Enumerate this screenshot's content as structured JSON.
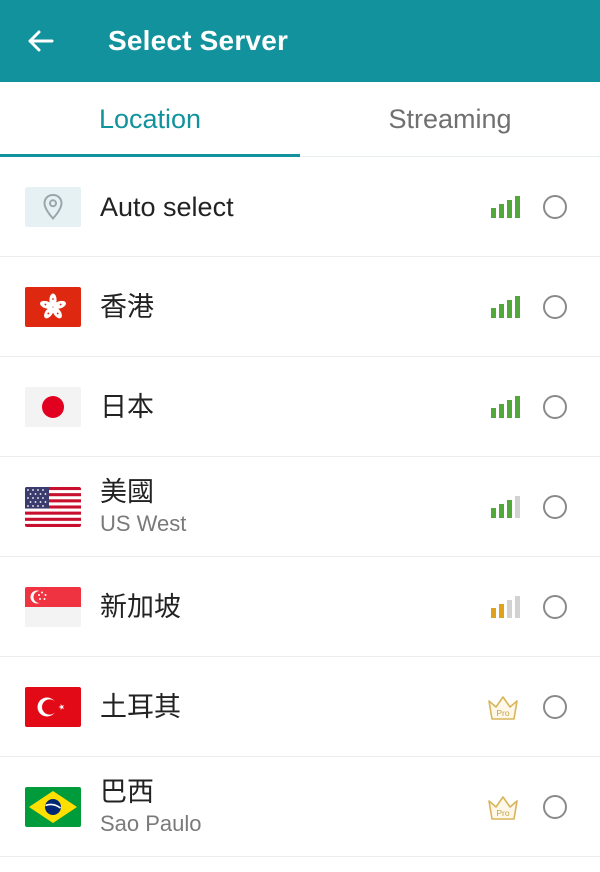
{
  "header": {
    "title": "Select Server",
    "back_icon": "arrow-left-icon"
  },
  "tabs": [
    {
      "label": "Location",
      "active": true
    },
    {
      "label": "Streaming",
      "active": false
    }
  ],
  "colors": {
    "primary": "#11929c",
    "signal_green": "#52a83a",
    "signal_orange": "#e0a21a",
    "signal_gray": "#d2d2d2",
    "pro_gold": "#d9b55a"
  },
  "servers": [
    {
      "name": "Auto select",
      "sub": "",
      "icon": "location-pin-icon",
      "signal": 4,
      "signal_color": "green",
      "pro": false
    },
    {
      "name": "香港",
      "sub": "",
      "icon": "hong-kong-flag-icon",
      "signal": 4,
      "signal_color": "green",
      "pro": false
    },
    {
      "name": "日本",
      "sub": "",
      "icon": "japan-flag-icon",
      "signal": 4,
      "signal_color": "green",
      "pro": false
    },
    {
      "name": "美國",
      "sub": "US West",
      "icon": "usa-flag-icon",
      "signal": 3,
      "signal_color": "green",
      "pro": false
    },
    {
      "name": "新加坡",
      "sub": "",
      "icon": "singapore-flag-icon",
      "signal": 2,
      "signal_color": "orange",
      "pro": false
    },
    {
      "name": "土耳其",
      "sub": "",
      "icon": "turkey-flag-icon",
      "signal": 0,
      "signal_color": "",
      "pro": true,
      "badge_label": "Pro"
    },
    {
      "name": "巴西",
      "sub": "Sao Paulo",
      "icon": "brazil-flag-icon",
      "signal": 0,
      "signal_color": "",
      "pro": true,
      "badge_label": "Pro"
    }
  ]
}
